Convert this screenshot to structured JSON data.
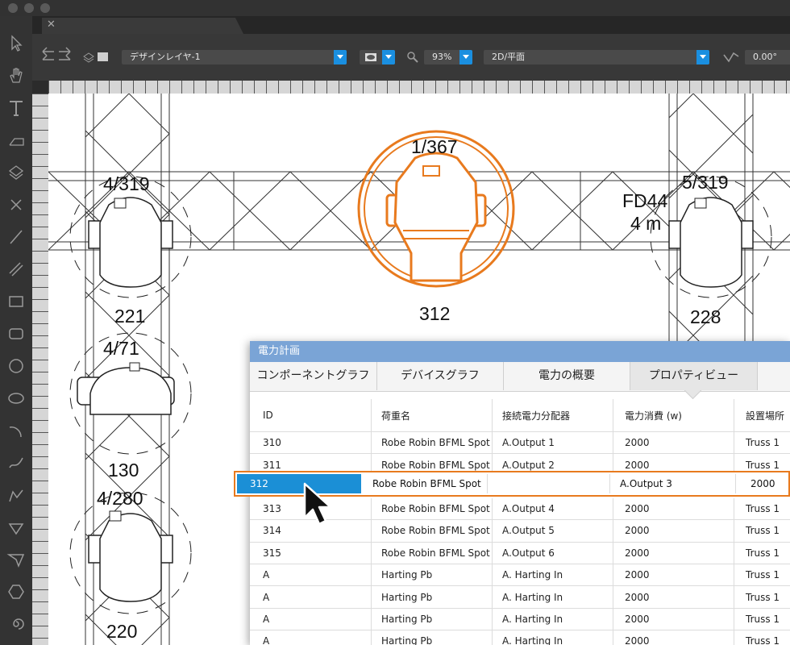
{
  "toolbar": {
    "layer_select": "デザインレイヤ-1",
    "zoom_select": "93%",
    "view_select": "2D/平面",
    "rotation_value": "0.00°"
  },
  "canvas": {
    "top_fixture_label": "1/367",
    "top_fixture_number": "312",
    "left_top_label": "4/319",
    "left_top_number": "221",
    "left_mid_label": "4/71",
    "left_mid_number": "130",
    "left_bottom_label": "4/280",
    "left_bottom_number": "220",
    "right_top_label": "5/319",
    "right_top_number": "228",
    "truss_label_line1": "FD44",
    "truss_label_line2": "4 m"
  },
  "panel": {
    "title": "電力計画",
    "tabs": [
      "コンポーネントグラフ",
      "デバイスグラフ",
      "電力の概要",
      "プロパティビュー"
    ],
    "active_tab": 3,
    "columns": [
      "ID",
      "荷重名",
      "接続電力分配器",
      "電力消費 (w)",
      "設置場所"
    ],
    "rows_top": [
      [
        "310",
        "Robe Robin BFML Spot",
        "A.Output 1",
        "2000",
        "Truss 1"
      ],
      [
        "311",
        "Robe Robin BFML Spot",
        "A.Output 2",
        "2000",
        "Truss 1"
      ]
    ],
    "selected_row": [
      "312",
      "Robe Robin BFML Spot",
      "",
      "A.Output 3",
      "2000"
    ],
    "rows_bottom": [
      [
        "313",
        "Robe Robin BFML Spot",
        "A.Output 4",
        "2000",
        "Truss 1"
      ],
      [
        "314",
        "Robe Robin BFML Spot",
        "A.Output 5",
        "2000",
        "Truss 1"
      ],
      [
        "315",
        "Robe Robin BFML Spot",
        "A.Output 6",
        "2000",
        "Truss 1"
      ],
      [
        "A",
        "Harting Pb",
        "A. Harting In",
        "2000",
        "Truss 1"
      ],
      [
        "A",
        "Harting Pb",
        "A. Harting In",
        "2000",
        "Truss 1"
      ],
      [
        "A",
        "Harting Pb",
        "A. Harting In",
        "2000",
        "Truss 1"
      ],
      [
        "A",
        "Harting Pb",
        "A. Harting In",
        "2000",
        "Truss 1"
      ]
    ]
  },
  "colors": {
    "accent": "#1b8fd6",
    "highlight": "#e87a1e",
    "panel_title": "#7aa4d6"
  }
}
